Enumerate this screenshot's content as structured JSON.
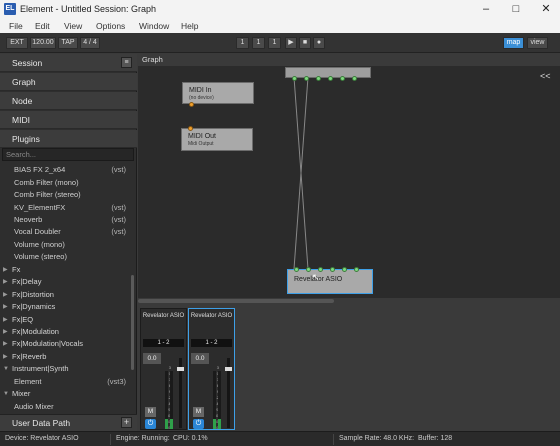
{
  "window": {
    "title": "Element - Untitled Session: Graph",
    "app_icon": "EL",
    "minimize_icon": "minimize-icon",
    "maximize_icon": "maximize-icon",
    "close_icon": "close-icon"
  },
  "menu": [
    "File",
    "Edit",
    "View",
    "Options",
    "Window",
    "Help"
  ],
  "toolbar": {
    "ext": "EXT",
    "tempo": "120.00",
    "tap": "TAP",
    "meter": "4 / 4",
    "counter": [
      "1",
      "1",
      "1"
    ],
    "transport_icons": [
      "play-icon",
      "stop-icon",
      "record-icon"
    ],
    "map": "map",
    "view": "view",
    "accent": "#3b8fd6"
  },
  "sidebar": {
    "nav": [
      "Session",
      "Graph",
      "Node",
      "MIDI",
      "Plugins"
    ],
    "search_placeholder": "Search...",
    "plugins": [
      {
        "name": "BIAS FX 2_x64",
        "format": "(vst)"
      },
      {
        "name": "Comb Filter (mono)",
        "format": ""
      },
      {
        "name": "Comb Filter (stereo)",
        "format": ""
      },
      {
        "name": "KV_ElementFX",
        "format": "(vst)"
      },
      {
        "name": "Neoverb",
        "format": "(vst)"
      },
      {
        "name": "Vocal Doubler",
        "format": "(vst)"
      },
      {
        "name": "Volume (mono)",
        "format": ""
      },
      {
        "name": "Volume (stereo)",
        "format": ""
      }
    ],
    "categories": [
      {
        "name": "Fx",
        "expanded": false
      },
      {
        "name": "Fx|Delay",
        "expanded": false
      },
      {
        "name": "Fx|Distortion",
        "expanded": false
      },
      {
        "name": "Fx|Dynamics",
        "expanded": false
      },
      {
        "name": "Fx|EQ",
        "expanded": false
      },
      {
        "name": "Fx|Modulation",
        "expanded": false
      },
      {
        "name": "Fx|Modulation|Vocals",
        "expanded": false
      },
      {
        "name": "Fx|Reverb",
        "expanded": false
      },
      {
        "name": "Instrument|Synth",
        "expanded": true
      },
      {
        "name": "Element",
        "format": "(vst3)",
        "child": true
      },
      {
        "name": "Mixer",
        "expanded": true
      },
      {
        "name": "Audio Mixer",
        "format": "",
        "child": true
      }
    ],
    "user_data": "User Data Path",
    "add_label": "+"
  },
  "graph": {
    "header": "Graph",
    "collapse_label": "<<",
    "nodes": [
      {
        "title": "MIDI In",
        "subtitle": "(no device)"
      },
      {
        "title": "MIDI Out",
        "subtitle": "Midi Output"
      },
      {
        "title": "",
        "subtitle": ""
      },
      {
        "title": "Revelator ASIO",
        "subtitle": ""
      }
    ],
    "port_colors": {
      "audio": "#7fd87f",
      "midi": "#f2a02c"
    }
  },
  "mixer": {
    "strips": [
      {
        "name": "Revelator ASIO",
        "io": "1 - 2",
        "gain": "0.0",
        "mute": "M",
        "selected": false
      },
      {
        "name": "Revelator ASIO",
        "io": "1 - 2",
        "gain": "0.0",
        "mute": "M",
        "selected": true
      }
    ],
    "scale": [
      "3",
      "0",
      "3",
      "6",
      "9",
      "12",
      "16",
      "20",
      "30",
      "40",
      "50"
    ]
  },
  "status": {
    "device": "Device: Revelator ASIO",
    "engine": "Engine: Running:",
    "cpu": "CPU: 0.1%",
    "sample_rate": "Sample Rate: 48.0 KHz:",
    "buffer": "Buffer: 128"
  }
}
